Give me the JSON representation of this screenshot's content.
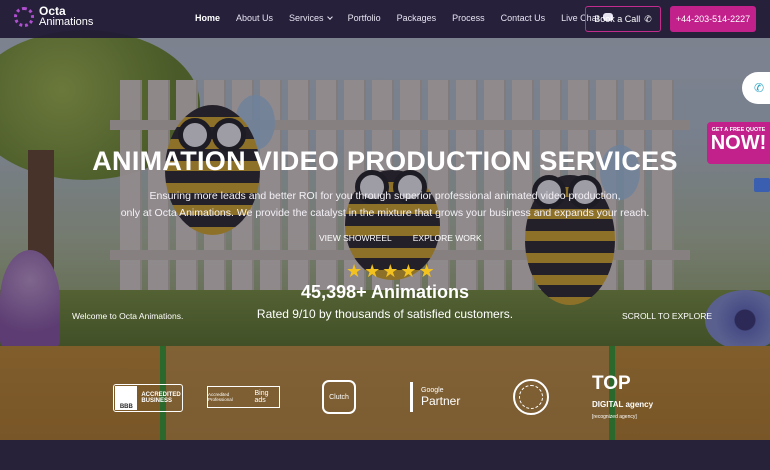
{
  "nav": {
    "logo_line1": "Octa",
    "logo_line2": "Animations",
    "items": [
      "Home",
      "About Us",
      "Services",
      "Portfolio",
      "Packages",
      "Process",
      "Contact Us",
      "Live Chat"
    ],
    "book_call": "Book a Call",
    "phone": "+44-203-514-2227"
  },
  "hero": {
    "title": "ANIMATION VIDEO PRODUCTION SERVICES",
    "sub_line1": "Ensuring more leads and better ROI for you through superior professional animated video production,",
    "sub_line2": "only at Octa Animations. We provide the catalyst in the mixture that grows your business and expands your reach.",
    "link_showreel": "VIEW SHOWREEL",
    "link_explore": "EXPLORE WORK",
    "rating_stars": 5,
    "count": "45,398+ Animations",
    "rated": "Rated 9/10 by thousands of satisfied customers.",
    "welcome": "Welcome to Octa Animations.",
    "scroll": "SCROLL TO EXPLORE"
  },
  "side": {
    "quote_small": "GET A FREE QUOTE",
    "quote_big": "NOW!"
  },
  "badges": {
    "bbb_line1": "ACCREDITED",
    "bbb_line2": "BUSINESS",
    "bbb_mark": "BBB",
    "bing_small": "Accredited Professional",
    "bing_main": "Bing ads",
    "clutch": "Clutch",
    "google_line1": "Google",
    "google_line2": "Partner",
    "top_main": "TOP",
    "top_side": "DIGITAL agency",
    "top_sub": "[recognized agency]"
  },
  "colors": {
    "accent": "#c2208a",
    "nav_bg": "#1e1834",
    "star": "#f4c21f"
  }
}
